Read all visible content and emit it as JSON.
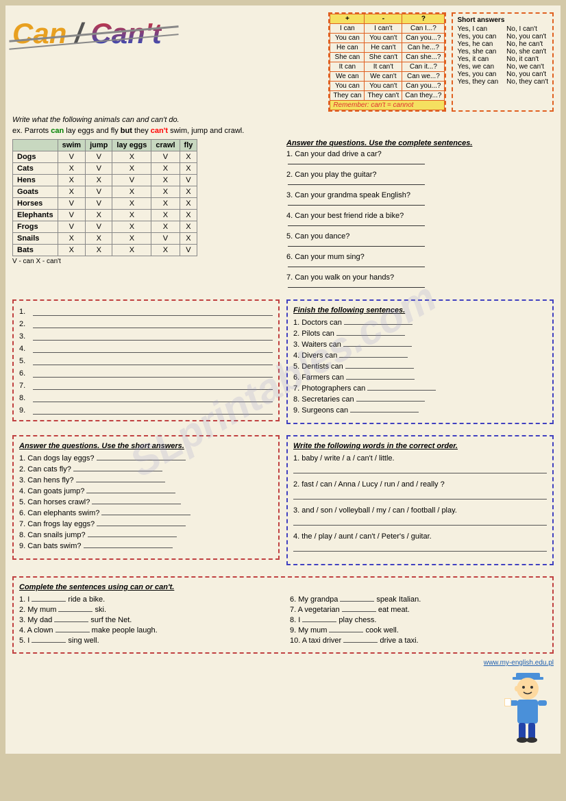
{
  "title": {
    "can": "Can",
    "slash": " / ",
    "cant": "Can't"
  },
  "grammar": {
    "headers": [
      "+",
      "-",
      "?"
    ],
    "rows": [
      [
        "I can",
        "I can't",
        "Can I...?"
      ],
      [
        "You can",
        "You can't",
        "Can you...?"
      ],
      [
        "He can",
        "He can't",
        "Can he...?"
      ],
      [
        "She can",
        "She can't",
        "Can she...?"
      ],
      [
        "It can",
        "It can't",
        "Can it...?"
      ],
      [
        "We can",
        "We can't",
        "Can we...?"
      ],
      [
        "You can",
        "You can't",
        "Can you...?"
      ],
      [
        "They can",
        "They can't",
        "Can they...?"
      ]
    ],
    "remember": "Remember: can't = cannot"
  },
  "short_answers": {
    "title": "Short answers",
    "pairs": [
      [
        "Yes, I can",
        "No, I can't"
      ],
      [
        "Yes, you can",
        "No, you can't"
      ],
      [
        "Yes, he can",
        "No, he can't"
      ],
      [
        "Yes, she can",
        "No, she can't"
      ],
      [
        "Yes, it can",
        "No, it can't"
      ],
      [
        "Yes, we can",
        "No, we can't"
      ],
      [
        "Yes, you can",
        "No, you can't"
      ],
      [
        "Yes, they can",
        "No, they can't"
      ]
    ]
  },
  "instruction1": "Write what the following animals can and can't do.",
  "example": "ex. Parrots can lay eggs and fly but they can't swim, jump and crawl.",
  "animals_table": {
    "headers": [
      "",
      "swim",
      "jump",
      "lay eggs",
      "crawl",
      "fly"
    ],
    "rows": [
      [
        "Dogs",
        "V",
        "V",
        "X",
        "V",
        "X"
      ],
      [
        "Cats",
        "X",
        "V",
        "X",
        "X",
        "X"
      ],
      [
        "Hens",
        "X",
        "X",
        "V",
        "X",
        "V"
      ],
      [
        "Goats",
        "X",
        "V",
        "X",
        "X",
        "X"
      ],
      [
        "Horses",
        "V",
        "V",
        "X",
        "X",
        "X"
      ],
      [
        "Elephants",
        "V",
        "X",
        "X",
        "X",
        "X"
      ],
      [
        "Frogs",
        "V",
        "V",
        "X",
        "X",
        "X"
      ],
      [
        "Snails",
        "X",
        "X",
        "X",
        "V",
        "X"
      ],
      [
        "Bats",
        "X",
        "X",
        "X",
        "X",
        "V"
      ]
    ],
    "legend": "V - can        X - can't"
  },
  "questions_section": {
    "title": "Answer the questions. Use the complete sentences.",
    "questions": [
      "1. Can your dad drive a car?",
      "2. Can you play the guitar?",
      "3. Can your grandma speak English?",
      "4. Can your best friend ride a bike?",
      "5. Can you dance?",
      "6. Can your mum sing?",
      "7. Can you walk on your hands?"
    ]
  },
  "writing_section": {
    "num_lines": 9
  },
  "finish_section": {
    "title": "Finish the following sentences.",
    "items": [
      "1. Doctors can",
      "2. Pilots can",
      "3. Waiters can",
      "4. Divers can",
      "5. Dentists can",
      "6. Farmers can",
      "7. Photographers can",
      "8. Secretaries can",
      "9. Surgeons can"
    ]
  },
  "short_q_section": {
    "title": "Answer the questions. Use the short answers.",
    "questions": [
      "1. Can dogs lay eggs?",
      "2. Can cats fly?",
      "3. Can hens fly?",
      "4. Can goats jump?",
      "5. Can horses crawl?",
      "6. Can elephants swim?",
      "7. Can frogs lay eggs?",
      "8. Can snails jump?",
      "9. Can bats swim?"
    ]
  },
  "correct_order": {
    "title": "Write the following words in the correct order.",
    "items": [
      "1. baby / write / a / can't / little.",
      "2. fast / can / Anna / Lucy / run / and / really ?",
      "3. and / son / volleyball / my / can / football / play.",
      "4. the / play / aunt / can't / Peter's / guitar."
    ]
  },
  "complete_section": {
    "title": "Complete the sentences using can or can't.",
    "items_left": [
      "1. I _______ ride a bike.",
      "2. My mum _______ ski.",
      "3. My dad _______ surf the Net.",
      "4. A clown _______ make people laugh.",
      "5. I _______ sing well."
    ],
    "items_right": [
      "6. My grandpa _______ speak Italian.",
      "7. A vegetarian _______ eat meat.",
      "8. I _______ play chess.",
      "9. My mum _______ cook well.",
      "10. A taxi driver _______ drive a taxi."
    ]
  },
  "website": "www.my-english.edu.pl",
  "watermark": "SLprintables.com"
}
